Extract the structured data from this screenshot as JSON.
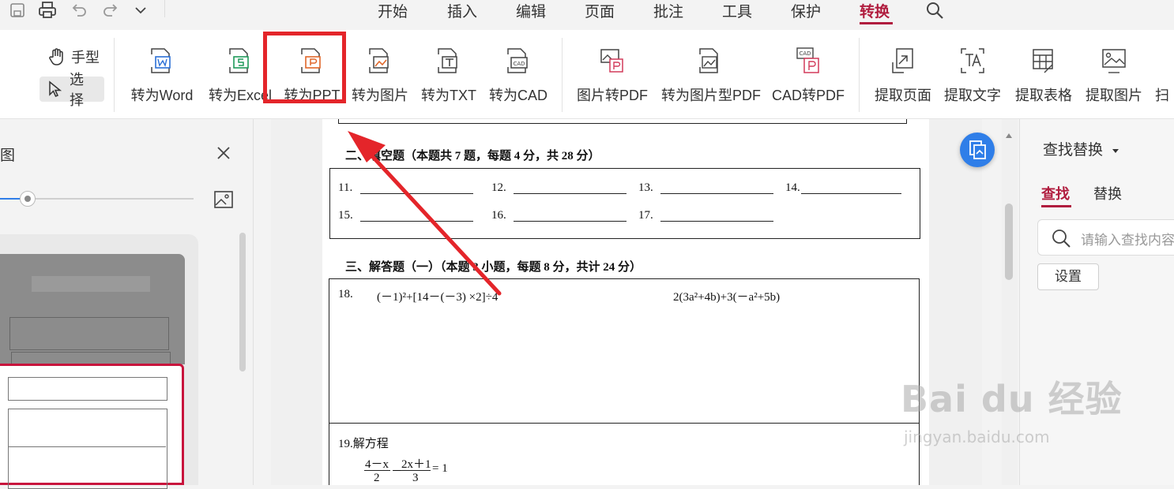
{
  "menu": {
    "items": [
      "开始",
      "插入",
      "编辑",
      "页面",
      "批注",
      "工具",
      "保护",
      "转换"
    ],
    "active": "转换"
  },
  "ribbon": {
    "hand_tool": "手型",
    "select_tool": "选择",
    "groups": [
      {
        "label": "转为Word",
        "icon": "word-icon",
        "accent": "#2b6fd6"
      },
      {
        "label": "转为Excel",
        "icon": "excel-icon",
        "accent": "#1f9a5a"
      },
      {
        "label": "转为PPT",
        "icon": "ppt-icon",
        "accent": "#e0672a"
      },
      {
        "label": "转为图片",
        "icon": "image-convert-icon",
        "accent": "#e0672a"
      },
      {
        "label": "转为TXT",
        "icon": "txt-icon",
        "accent": "#444444"
      },
      {
        "label": "转为CAD",
        "icon": "cad-icon",
        "accent": "#444444"
      },
      {
        "label": "图片转PDF",
        "icon": "image-to-pdf-icon",
        "accent": "#d23a5a"
      },
      {
        "label": "转为图片型PDF",
        "icon": "image-pdf-icon",
        "accent": "#444444"
      },
      {
        "label": "CAD转PDF",
        "icon": "cad-to-pdf-icon",
        "accent": "#d23a5a"
      },
      {
        "label": "提取页面",
        "icon": "extract-page-icon",
        "accent": "#444444"
      },
      {
        "label": "提取文字",
        "icon": "extract-text-icon",
        "accent": "#444444"
      },
      {
        "label": "提取表格",
        "icon": "extract-table-icon",
        "accent": "#444444"
      },
      {
        "label": "提取图片",
        "icon": "extract-image-icon",
        "accent": "#444444"
      },
      {
        "label": "扫",
        "icon": "scan-icon",
        "accent": "#444444"
      }
    ]
  },
  "left_panel": {
    "title_fragment": "图"
  },
  "document": {
    "section2_title": "二、填空题（本题共 7 题，每题 4 分，共 28 分）",
    "blanks_row1": [
      "11.",
      "12.",
      "13.",
      "14."
    ],
    "blanks_row2": [
      "15.",
      "16.",
      "17."
    ],
    "section3_title": "三、解答题（一）（本题 3 小题，每题 8 分，共计 24 分）",
    "q18_num": "18.",
    "q18_expr1": "(－1)²+[14－(－3) ×2]÷4",
    "q18_expr2": "2(3a²+4b)+3(－a²+5b)",
    "q19_title": "19.解方程",
    "q19_frac1_num": "4－x",
    "q19_frac1_den": "2",
    "q19_minus": "－",
    "q19_frac2_num": "2x＋1",
    "q19_frac2_den": "3",
    "q19_eq": "= 1"
  },
  "right_panel": {
    "title": "查找替换",
    "tab_find": "查找",
    "tab_replace": "替换",
    "search_placeholder": "请输入查找内容",
    "settings_button": "设置"
  },
  "watermark": {
    "brand": "Bai du 经验",
    "url": "jingyan.baidu.com"
  },
  "colors": {
    "accent": "#b01c3e",
    "highlight_box": "#e4252a",
    "arrow": "#e4252a",
    "float_button": "#2f7ee8"
  }
}
